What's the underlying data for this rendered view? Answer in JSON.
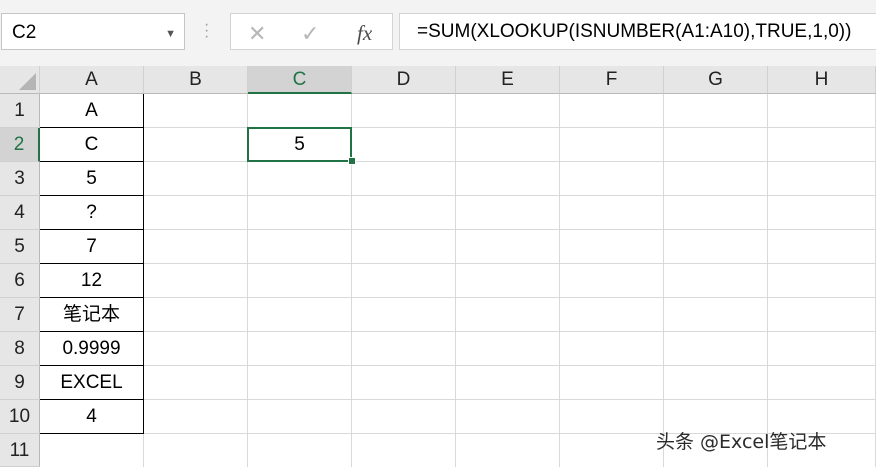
{
  "name_box": {
    "value": "C2"
  },
  "formula_bar": {
    "cancel_glyph": "✕",
    "enter_glyph": "✓",
    "fx_label": "fx",
    "formula": "=SUM(XLOOKUP(ISNUMBER(A1:A10),TRUE,1,0))"
  },
  "columns": [
    "A",
    "B",
    "C",
    "D",
    "E",
    "F",
    "G",
    "H"
  ],
  "rows": [
    "1",
    "2",
    "3",
    "4",
    "5",
    "6",
    "7",
    "8",
    "9",
    "10",
    "11"
  ],
  "column_a_values": [
    "A",
    "C",
    "5",
    "?",
    "7",
    "12",
    "笔记本",
    "0.9999",
    "EXCEL",
    "4"
  ],
  "selected_cell": {
    "ref": "C2",
    "value": "5"
  },
  "watermark": "头条 @Excel笔记本",
  "colors": {
    "accent": "#217346",
    "header_bg": "#e6e6e6",
    "gridline": "#d9d9d9"
  }
}
